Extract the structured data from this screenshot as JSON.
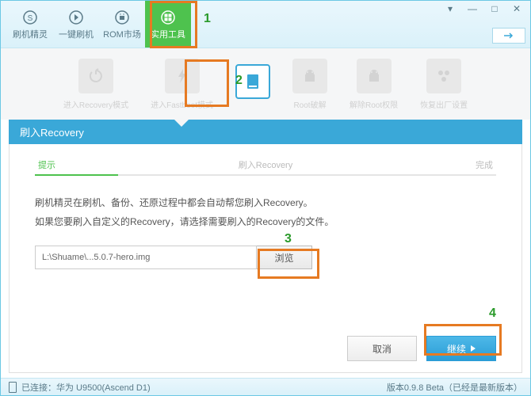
{
  "nav": {
    "items": [
      {
        "label": "刷机精灵"
      },
      {
        "label": "一键刷机"
      },
      {
        "label": "ROM市场"
      },
      {
        "label": "实用工具"
      }
    ]
  },
  "tools": {
    "items": [
      {
        "label": "进入Recovery模式"
      },
      {
        "label": "进入Fastboot模式"
      },
      {
        "label": ""
      },
      {
        "label": "Root破解"
      },
      {
        "label": "解除Root权限"
      },
      {
        "label": "恢复出厂设置"
      }
    ]
  },
  "panel": {
    "title": "刷入Recovery",
    "steps": {
      "s1": "提示",
      "s2": "刷入Recovery",
      "s3": "完成"
    },
    "line1": "刷机精灵在刷机、备份、还原过程中都会自动帮您刷入Recovery。",
    "line2": "如果您要刷入自定义的Recovery，请选择需要刷入的Recovery的文件。",
    "filepath": "L:\\Shuame\\...5.0.7-hero.img",
    "browse": "浏览",
    "cancel": "取消",
    "continue": "继续"
  },
  "status": {
    "connected": "已连接：华为 U9500(Ascend D1)",
    "version": "版本0.9.8 Beta（已经是最新版本）"
  },
  "annots": {
    "a1": "1",
    "a2": "2",
    "a3": "3",
    "a4": "4"
  }
}
